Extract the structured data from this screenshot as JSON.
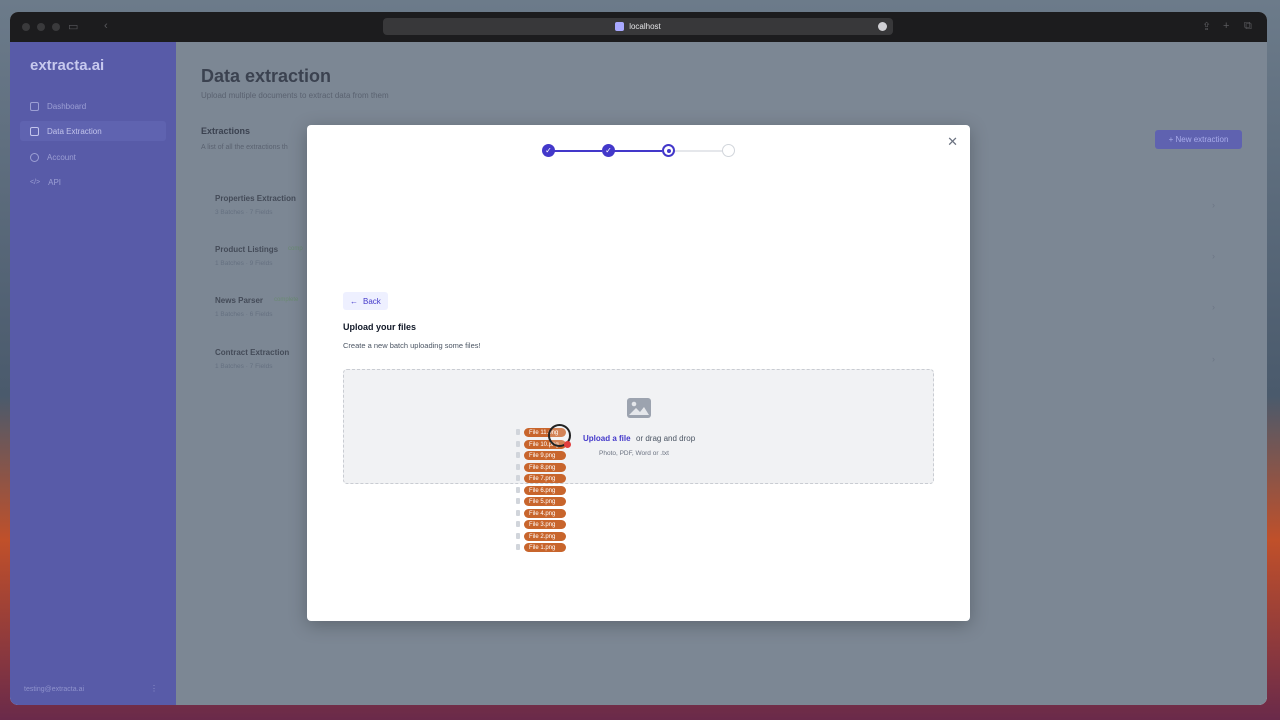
{
  "browser": {
    "url": "localhost"
  },
  "sidebar": {
    "logo": "extracta.ai",
    "items": [
      {
        "label": "Dashboard",
        "icon": "home-icon",
        "active": false
      },
      {
        "label": "Data Extraction",
        "icon": "document-icon",
        "active": true
      },
      {
        "label": "Account",
        "icon": "user-icon",
        "active": false
      },
      {
        "label": "API",
        "icon": "code-icon",
        "active": false
      }
    ],
    "user_email": "testing@extracta.ai",
    "user_menu": "⋮"
  },
  "main": {
    "title": "Data extraction",
    "subtitle": "Upload multiple documents to extract data from them",
    "section_title": "Extractions",
    "section_subtitle": "A list of all the extractions th",
    "new_button": "+ New extraction",
    "extractions": [
      {
        "name": "Properties Extraction",
        "meta": "3 Batches · 7 Fields",
        "badge": ""
      },
      {
        "name": "Product Listings",
        "meta": "1 Batches · 9 Fields",
        "badge": "comp"
      },
      {
        "name": "News Parser",
        "meta": "1 Batches · 6 Fields",
        "badge": "complete"
      },
      {
        "name": "Contract Extraction",
        "meta": "1 Batches · 7 Fields",
        "badge": ""
      }
    ]
  },
  "modal": {
    "close": "✕",
    "steps": [
      "done",
      "done",
      "current",
      "todo"
    ],
    "back_label": "Back",
    "upload_title": "Upload your files",
    "upload_subtitle": "Create a new batch uploading some files!",
    "upload_link": "Upload a file",
    "upload_or": "or drag and drop",
    "upload_types": "Photo, PDF, Word or .txt",
    "dragged_files": [
      "File 11.png",
      "File 10.png",
      "File 9.png",
      "File 8.png",
      "File 7.png",
      "File 6.png",
      "File 5.png",
      "File 4.png",
      "File 3.png",
      "File 2.png",
      "File 1.png"
    ]
  },
  "colors": {
    "accent": "#4338ca",
    "sidebar": "#585ba8",
    "file_tag": "#c8652c"
  }
}
